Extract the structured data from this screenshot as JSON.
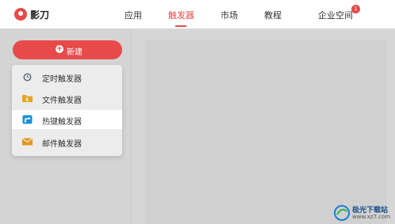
{
  "app": {
    "name": "影刀"
  },
  "nav": {
    "items": [
      {
        "label": "应用"
      },
      {
        "label": "触发器"
      },
      {
        "label": "市场"
      },
      {
        "label": "教程"
      },
      {
        "label": "企业空间"
      }
    ],
    "badge": "1"
  },
  "new_button": {
    "label": "新建"
  },
  "dropdown": {
    "items": [
      {
        "label": "定时触发器",
        "icon": "clock-icon"
      },
      {
        "label": "文件触发器",
        "icon": "folder-icon"
      },
      {
        "label": "热键触发器",
        "icon": "hotkey-icon"
      },
      {
        "label": "邮件触发器",
        "icon": "mail-icon"
      }
    ]
  },
  "watermark": {
    "text": "极光下载站",
    "sub": "www.xz7.com"
  },
  "colors": {
    "accent": "#e84a4a"
  }
}
